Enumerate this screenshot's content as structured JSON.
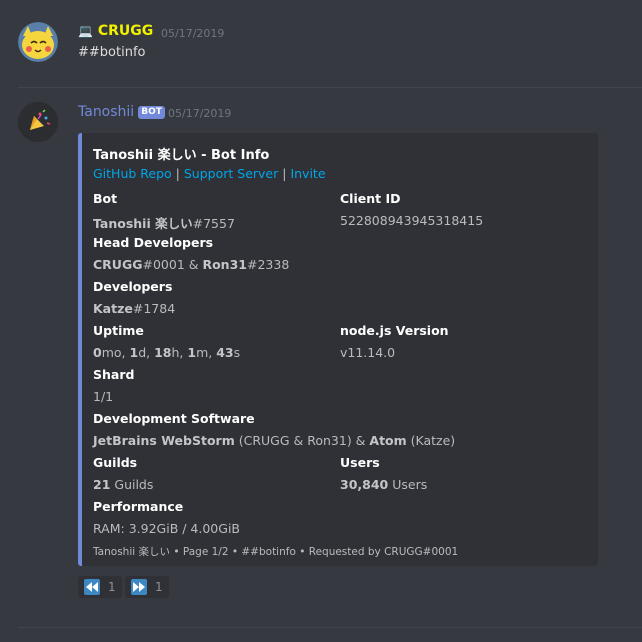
{
  "messages": [
    {
      "author": "CRUGG",
      "author_prefix": "💻",
      "timestamp": "05/17/2019",
      "content": "##botinfo"
    },
    {
      "author": "Tanoshii",
      "bot_tag": "BOT",
      "timestamp": "05/17/2019"
    }
  ],
  "embed": {
    "title": "Tanoshii 楽しい - Bot Info",
    "links": [
      "GitHub Repo",
      "Support Server",
      "Invite"
    ],
    "link_separator": "|",
    "fields": {
      "bot": {
        "name": "Bot",
        "value_bold": "Tanoshii 楽しい",
        "value_rest": "#7557"
      },
      "client_id": {
        "name": "Client ID",
        "value": "522808943945318415"
      },
      "head_devs": {
        "name": "Head Developers",
        "dev1_bold": "CRUGG",
        "dev1_rest": "#0001 & ",
        "dev2_bold": "Ron31",
        "dev2_rest": "#2338"
      },
      "developers": {
        "name": "Developers",
        "value_bold": "Katze",
        "value_rest": "#1784"
      },
      "uptime": {
        "name": "Uptime",
        "months": "0",
        "months_unit": "mo, ",
        "days": "1",
        "days_unit": "d, ",
        "hours": "18",
        "hours_unit": "h, ",
        "minutes": "1",
        "minutes_unit": "m, ",
        "seconds": "43",
        "seconds_unit": "s"
      },
      "nodejs": {
        "name": "node.js Version",
        "value": "v11.14.0"
      },
      "shard": {
        "name": "Shard",
        "value": "1/1"
      },
      "dev_software": {
        "name": "Development Software",
        "sw1_bold": "JetBrains WebStorm",
        "sw1_rest": " (CRUGG & Ron31) & ",
        "sw2_bold": "Atom",
        "sw2_rest": " (Katze)"
      },
      "guilds": {
        "name": "Guilds",
        "value_bold": "21",
        "value_rest": " Guilds"
      },
      "users": {
        "name": "Users",
        "value_bold": "30,840",
        "value_rest": " Users"
      },
      "performance": {
        "name": "Performance",
        "value": "RAM: 3.92GiB / 4.00GiB"
      }
    },
    "footer": "Tanoshii 楽しい • Page 1/2 • ##botinfo • Requested by CRUGG#0001",
    "accent_color": "#7289da"
  },
  "reactions": [
    {
      "emoji": "rewind-icon",
      "count": "1"
    },
    {
      "emoji": "fast-forward-icon",
      "count": "1"
    }
  ],
  "colors": {
    "background": "#36393f",
    "embed_bg": "#2f3136",
    "crugg_name": "#f1f100",
    "tanoshii_name": "#7289da",
    "link": "#00a6e8"
  }
}
